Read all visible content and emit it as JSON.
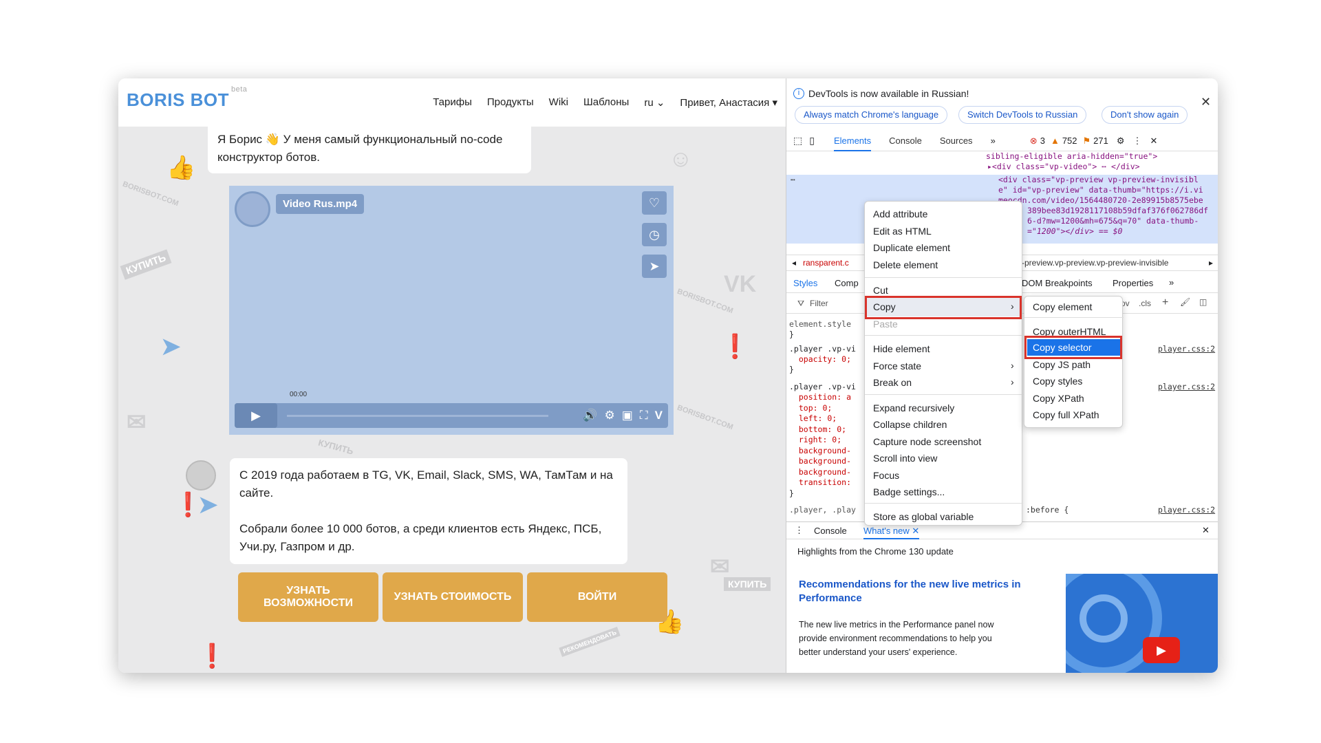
{
  "site": {
    "logo": "BORIS BOT",
    "logo_badge": "beta",
    "nav": [
      "Тарифы",
      "Продукты",
      "Wiki",
      "Шаблоны",
      "ru",
      "Привет, Анастасия"
    ],
    "bubble1": "Я Борис 👋 У меня самый функциональный no-code конструктор ботов.",
    "video": {
      "title": "Video Rus.mp4",
      "time": "00:00"
    },
    "bubble2_p1": "С 2019 года работаем в TG, VK,  Email, Slack, SMS, WA, ТамТам и на сайте.",
    "bubble2_p2": "Собрали более 10 000 ботов, а среди клиентов есть Яндекс, ПСБ, Учи.ру, Газпром и др.",
    "buttons": [
      "УЗНАТЬ ВОЗМОЖНОСТИ",
      "УЗНАТЬ СТОИМОСТЬ",
      "ВОЙТИ"
    ],
    "bg_words": [
      "BORISBOT.COM",
      "КУПИТЬ",
      "BORISBOT.COM",
      "КУПИТЬ",
      "BORISBOT.COM",
      "КУПИТЬ",
      "РЕКОМЕНДОВАТЬ"
    ]
  },
  "devtools": {
    "info": "DevTools is now available in Russian!",
    "pills": [
      "Always match Chrome's language",
      "Switch DevTools to Russian",
      "Don't show again"
    ],
    "tabs": [
      "Elements",
      "Console",
      "Sources"
    ],
    "errors": "3",
    "warnings": "752",
    "issues": "271",
    "dom_lines": [
      "sibling-eligible aria-hidden=\"true\">",
      "▸<div class=\"vp-video\"> ⋯ </div>",
      "<div class=\"vp-preview vp-preview-invisibl",
      "e\" id=\"vp-preview\" data-thumb=\"https://i.vi",
      "meocdn.com/video/1564480720-2e89915b8575ebe",
      "389bee83d1928117108b59dfaf376f062786df",
      "6-d?mw=1200&mh=675&q=70\" data-thumb-",
      "=\"1200\"></div> == $0"
    ],
    "dom_dots": "⋯",
    "bread_left": "ransparent.c",
    "bread_right": "-preview.vp-preview.vp-preview-invisible",
    "style_tabs": [
      "Styles",
      "Comp",
      "DOM Breakpoints",
      "Properties"
    ],
    "filter": "Filter",
    "hov": "ov",
    "cls": ".cls",
    "styles_lines": [
      "element.style",
      "}",
      ".player .vp-vi",
      "  opacity: 0;",
      "}",
      ".player .vp-vi",
      "  position: a",
      "  top: 0;",
      "  left: 0;",
      "  bottom: 0;",
      "  right: 0;",
      "  background-",
      "  background-",
      "  background-",
      "  transition:",
      "}",
      ".player, .play"
    ],
    "style_src": [
      "player.css:2",
      "player.css:2",
      "player.css:2"
    ],
    "before": ":before {",
    "drawer_tabs": [
      "Console",
      "What's new"
    ],
    "wn_top": "Highlights from the Chrome 130 update",
    "wn_title": "Recommendations for the new live metrics in Performance",
    "wn_body": "The new live metrics in the Performance panel now provide environment recommendations to help you better understand your users' experience."
  },
  "context_menu": [
    "Add attribute",
    "Edit as HTML",
    "Duplicate element",
    "Delete element",
    "Cut",
    "Copy",
    "Paste",
    "Hide element",
    "Force state",
    "Break on",
    "Expand recursively",
    "Collapse children",
    "Capture node screenshot",
    "Scroll into view",
    "Focus",
    "Badge settings...",
    "Store as global variable"
  ],
  "submenu": [
    "Copy element",
    "Copy outerHTML",
    "Copy selector",
    "Copy JS path",
    "Copy styles",
    "Copy XPath",
    "Copy full XPath"
  ],
  "colors": {
    "accent": "#1a73e8",
    "highlight": "#d9332b",
    "orange": "#e0a84a",
    "video": "#b4c9e6"
  }
}
